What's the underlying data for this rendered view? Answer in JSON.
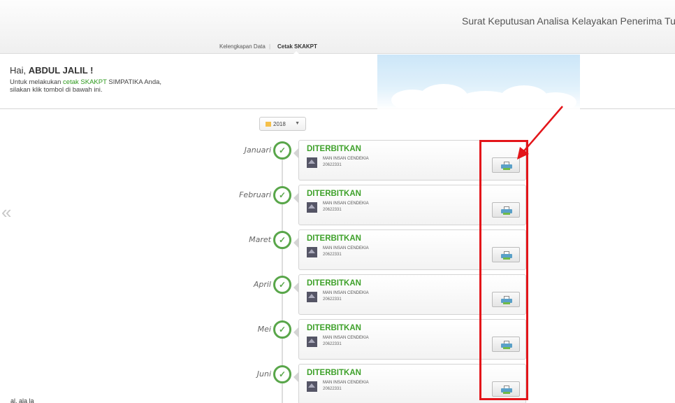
{
  "header": {
    "app_title": "Surat Keputusan Analisa Kelayakan Penerima Tunjar",
    "tabs": [
      {
        "label": "Kelengkapan Data",
        "active": false
      },
      {
        "label": "Cetak SKAKPT",
        "active": true
      }
    ]
  },
  "greeting": {
    "hello_prefix": "Hai, ",
    "user_name": "ABDUL JALIL !",
    "line1_prefix": "Untuk melakukan ",
    "line1_highlight": "cetak SKAKPT",
    "line1_suffix": " SIMPATIKA Anda,",
    "line2": "silakan klik tombol di bawah ini."
  },
  "nav": {
    "prev_icon": "double-chevron-left-icon",
    "prev_glyph": "«"
  },
  "year_select": {
    "value": "2018",
    "icon": "calendar-icon",
    "chevron": "▼"
  },
  "timeline": [
    {
      "month": "Januari",
      "status": "DITERBITKAN",
      "school": "MAN INSAN CENDEKIA",
      "nsm": "20622331"
    },
    {
      "month": "Februari",
      "status": "DITERBITKAN",
      "school": "MAN INSAN CENDEKIA",
      "nsm": "20622331"
    },
    {
      "month": "Maret",
      "status": "DITERBITKAN",
      "school": "MAN INSAN CENDEKIA",
      "nsm": "20622331"
    },
    {
      "month": "April",
      "status": "DITERBITKAN",
      "school": "MAN INSAN CENDEKIA",
      "nsm": "20622331"
    },
    {
      "month": "Mei",
      "status": "DITERBITKAN",
      "school": "MAN INSAN CENDEKIA",
      "nsm": "20622331"
    },
    {
      "month": "Juni",
      "status": "DITERBITKAN",
      "school": "MAN INSAN CENDEKIA",
      "nsm": "20622331"
    }
  ],
  "check_glyph": "✓",
  "colors": {
    "status_green": "#3ea12a",
    "check_green": "#59a64a",
    "highlight_red": "#e3151a"
  },
  "bottom_text": "al. ala la"
}
